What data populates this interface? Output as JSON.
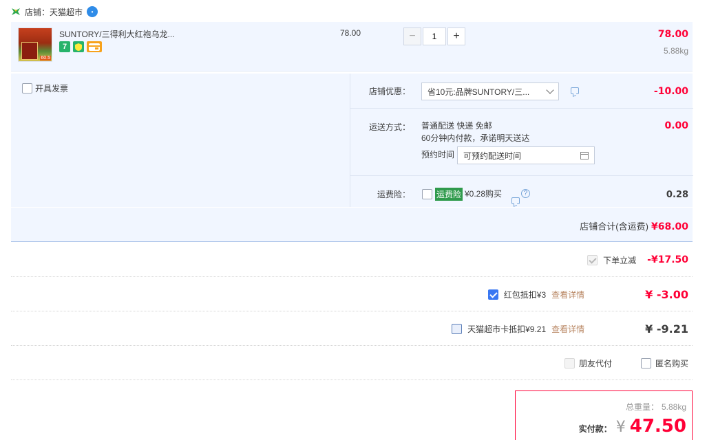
{
  "shop": {
    "label": "店铺：天猫超市"
  },
  "item": {
    "title": "SUNTORY/三得利大红袍乌龙...",
    "unit_price": "78.00",
    "quantity": "1",
    "subtotal": "78.00",
    "weight": "5.88kg",
    "badges": [
      "7",
      "shield",
      "card"
    ]
  },
  "invoice": {
    "label": "开具发票"
  },
  "shop_discount": {
    "label": "店铺优惠：",
    "selected": "省10元:品牌SUNTORY/三...",
    "amount": "-10.00"
  },
  "shipping": {
    "label": "运送方式：",
    "line1": "普通配送 快递 免邮",
    "line2": "60分钟内付款，承诺明天送达",
    "reserve_label": "预约时间",
    "reserve_placeholder": "可预约配送时间",
    "amount": "0.00"
  },
  "insurance": {
    "label": "运费险：",
    "tag": "运费险",
    "price_text": "¥0.28购买",
    "amount": "0.28"
  },
  "shop_total": {
    "label": "店铺合计(含运费)",
    "amount": "¥68.00"
  },
  "instant_discount": {
    "label": "下单立减",
    "amount": "-¥17.50"
  },
  "red_packet": {
    "label": "红包抵扣¥3",
    "link": "查看详情",
    "amount": "¥ -3.00"
  },
  "tmall_card": {
    "label": "天猫超市卡抵扣¥9.21",
    "link": "查看详情",
    "amount": "¥ -9.21"
  },
  "pay_options": {
    "friend": "朋友代付",
    "anonymous": "匿名购买"
  },
  "payment": {
    "weight_label": "总重量：",
    "weight": "5.88kg",
    "total_label": "实付款：",
    "currency": "¥",
    "total": "47.50"
  },
  "colors": {
    "accent_red": "#ff0036",
    "panel_blue": "#f1f6ff",
    "checkbox_blue": "#3a78f2",
    "link_brown": "#b88662"
  }
}
